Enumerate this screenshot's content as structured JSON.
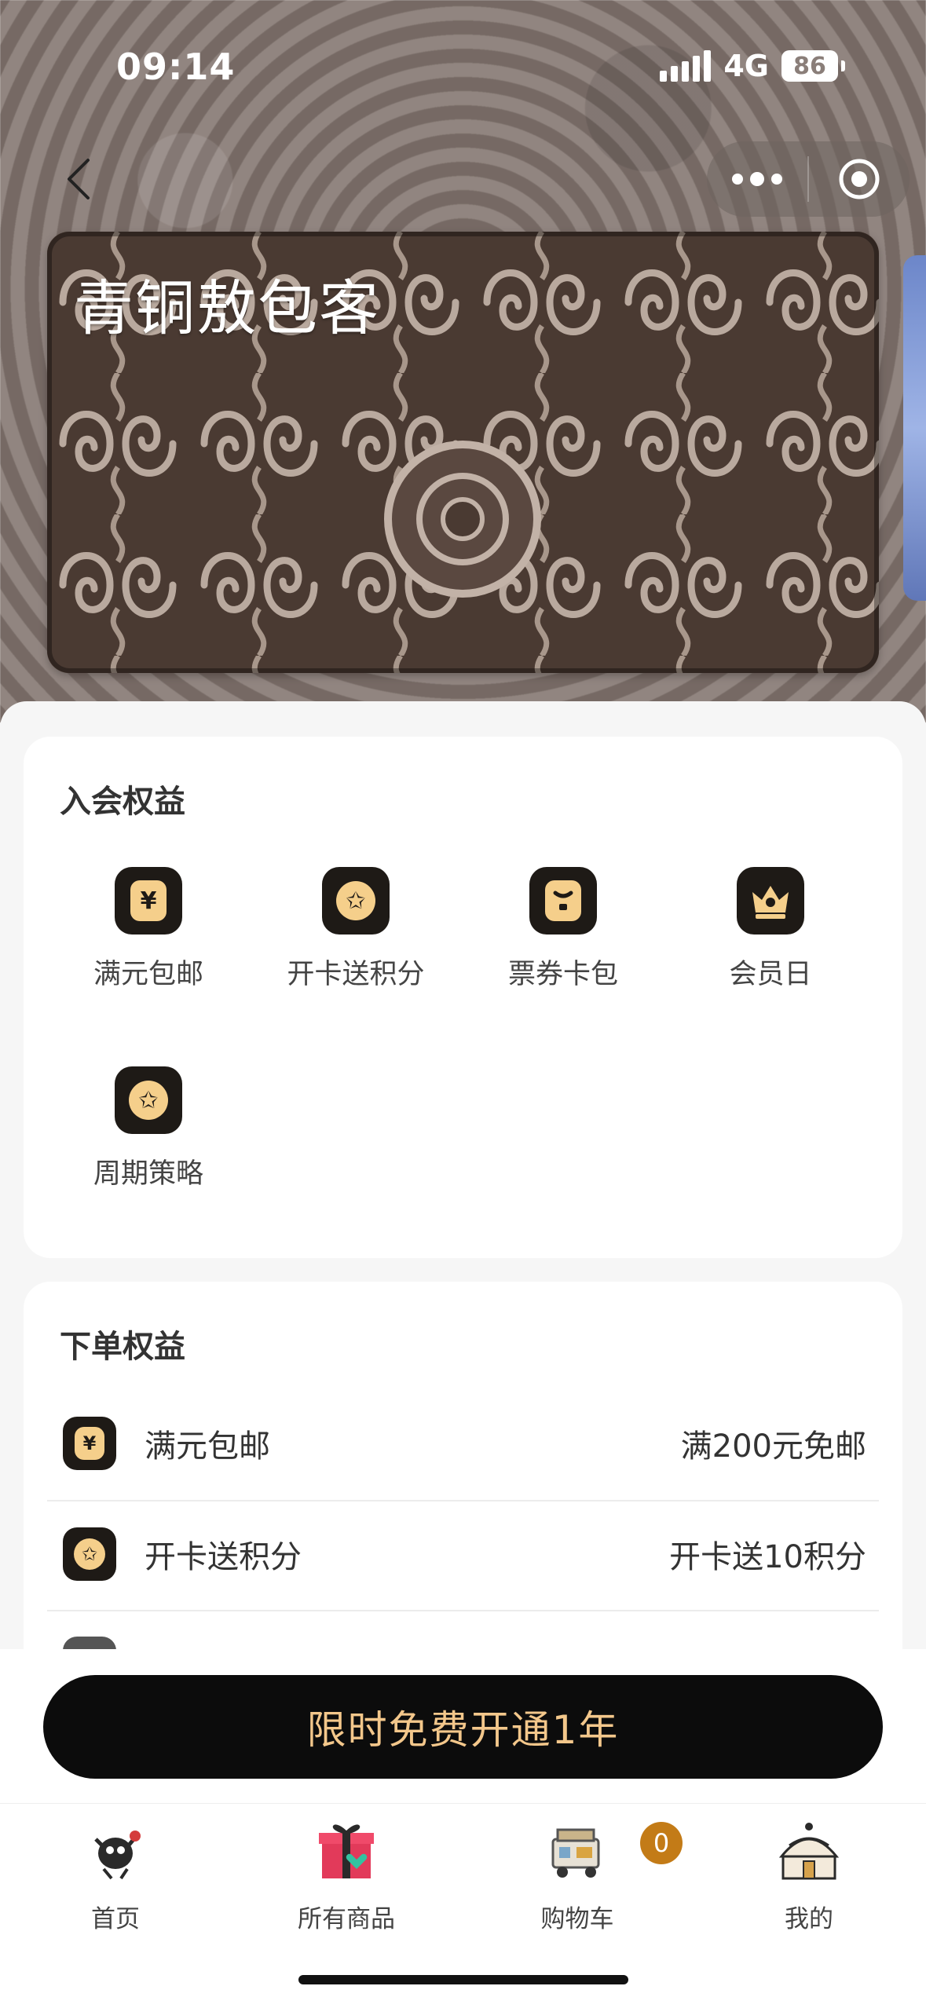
{
  "status_bar": {
    "time": "09:14",
    "network": "4G",
    "battery": "86"
  },
  "card": {
    "title": "青铜敖包客"
  },
  "join_benefits": {
    "title": "入会权益",
    "items": [
      {
        "label": "满元包邮",
        "icon": "yen-icon"
      },
      {
        "label": "开卡送积分",
        "icon": "star-badge-icon"
      },
      {
        "label": "票券卡包",
        "icon": "wallet-icon"
      },
      {
        "label": "会员日",
        "icon": "crown-icon"
      },
      {
        "label": "周期策略",
        "icon": "star-badge-icon"
      }
    ]
  },
  "order_benefits": {
    "title": "下单权益",
    "rows": [
      {
        "name": "满元包邮",
        "value": "满200元免邮",
        "icon": "yen-icon"
      },
      {
        "name": "开卡送积分",
        "value": "开卡送10积分",
        "icon": "star-badge-icon"
      }
    ]
  },
  "cta": {
    "label": "限时免费开通1年"
  },
  "tabbar": {
    "tabs": [
      {
        "label": "首页",
        "icon": "home-mascot-icon"
      },
      {
        "label": "所有商品",
        "icon": "gift-box-icon"
      },
      {
        "label": "购物车",
        "icon": "cart-icon"
      },
      {
        "label": "我的",
        "icon": "yurt-icon"
      }
    ],
    "cart_count": "0"
  },
  "colors": {
    "accent_gold": "#f3c78b",
    "icon_bg": "#1e1a16",
    "badge": "#c37b17"
  }
}
